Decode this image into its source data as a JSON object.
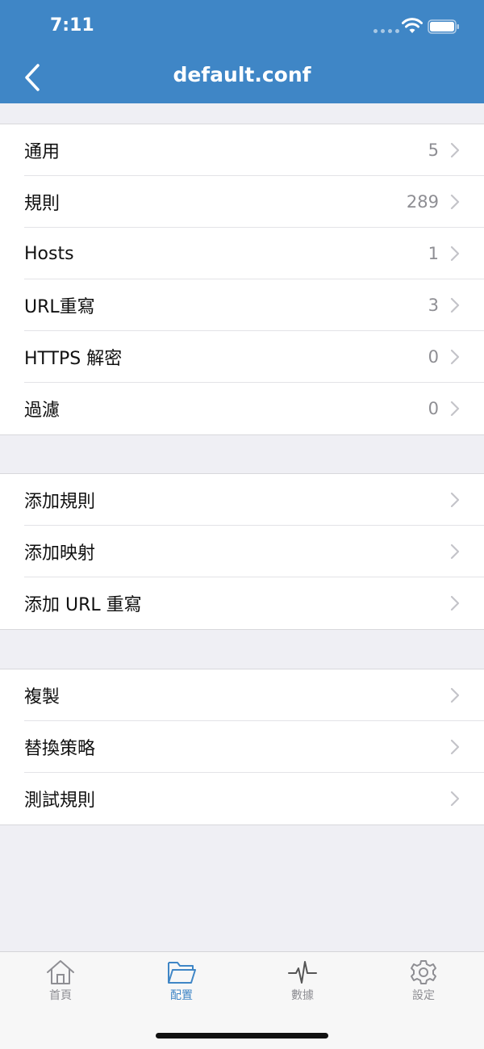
{
  "status_bar": {
    "time": "7:11"
  },
  "nav": {
    "title": "default.conf",
    "back_icon": "chevron-left-icon"
  },
  "section1": {
    "items": [
      {
        "label": "通用",
        "value": "5"
      },
      {
        "label": "規則",
        "value": "289"
      },
      {
        "label": "Hosts",
        "value": "1"
      },
      {
        "label": "URL重寫",
        "value": "3"
      },
      {
        "label": "HTTPS 解密",
        "value": "0"
      },
      {
        "label": "過濾",
        "value": "0"
      }
    ]
  },
  "section2": {
    "items": [
      {
        "label": "添加規則"
      },
      {
        "label": "添加映射"
      },
      {
        "label": "添加 URL 重寫"
      }
    ]
  },
  "section3": {
    "items": [
      {
        "label": "複製"
      },
      {
        "label": "替換策略"
      },
      {
        "label": "測試規則"
      }
    ]
  },
  "tabbar": {
    "tabs": [
      {
        "label": "首頁",
        "icon": "home-icon",
        "active": false
      },
      {
        "label": "配置",
        "icon": "folder-icon",
        "active": true
      },
      {
        "label": "數據",
        "icon": "pulse-icon",
        "active": false
      },
      {
        "label": "設定",
        "icon": "gear-icon",
        "active": false
      }
    ]
  },
  "colors": {
    "accent": "#3f86c6",
    "background": "#efeff4",
    "inactive_tab": "#8e8e93"
  }
}
